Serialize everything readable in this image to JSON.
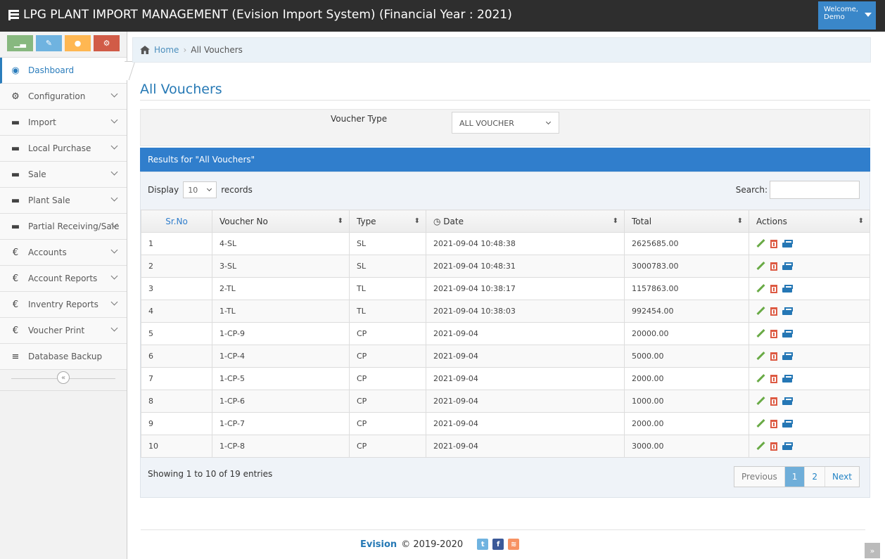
{
  "header": {
    "title": "LPG PLANT IMPORT MANAGEMENT (Evision Import System) (Financial Year : 2021)",
    "welcome": "Welcome,",
    "user": "Demo"
  },
  "sidebar": {
    "items": [
      {
        "label": "Dashboard",
        "icon": "tachometer-icon",
        "active": true
      },
      {
        "label": "Configuration",
        "icon": "cogs-icon"
      },
      {
        "label": "Import",
        "icon": "cart-icon"
      },
      {
        "label": "Local Purchase",
        "icon": "cart-icon"
      },
      {
        "label": "Sale",
        "icon": "cart-icon"
      },
      {
        "label": "Plant Sale",
        "icon": "cart-icon"
      },
      {
        "label": "Partial Receiving/Sale",
        "icon": "cart-icon"
      },
      {
        "label": "Accounts",
        "icon": "euro-icon"
      },
      {
        "label": "Account Reports",
        "icon": "euro-icon"
      },
      {
        "label": "Inventry Reports",
        "icon": "euro-icon"
      },
      {
        "label": "Voucher Print",
        "icon": "euro-icon"
      },
      {
        "label": "Database Backup",
        "icon": "database-icon"
      }
    ]
  },
  "breadcrumb": {
    "home": "Home",
    "current": "All Vouchers"
  },
  "page": {
    "title": "All Vouchers"
  },
  "filter": {
    "label": "Voucher Type",
    "selected": "ALL VOUCHER"
  },
  "results": {
    "header": "Results for \"All Vouchers\""
  },
  "table": {
    "display_label": "Display",
    "records_label": "records",
    "length": "10",
    "search_label": "Search:",
    "columns": [
      "Sr.No",
      "Voucher No",
      "Type",
      "Date",
      "Total",
      "Actions"
    ],
    "rows": [
      [
        "1",
        "4-SL",
        "SL",
        "2021-09-04 10:48:38",
        "2625685.00"
      ],
      [
        "2",
        "3-SL",
        "SL",
        "2021-09-04 10:48:31",
        "3000783.00"
      ],
      [
        "3",
        "2-TL",
        "TL",
        "2021-09-04 10:38:17",
        "1157863.00"
      ],
      [
        "4",
        "1-TL",
        "TL",
        "2021-09-04 10:38:03",
        "992454.00"
      ],
      [
        "5",
        "1-CP-9",
        "CP",
        "2021-09-04",
        "20000.00"
      ],
      [
        "6",
        "1-CP-4",
        "CP",
        "2021-09-04",
        "5000.00"
      ],
      [
        "7",
        "1-CP-5",
        "CP",
        "2021-09-04",
        "2000.00"
      ],
      [
        "8",
        "1-CP-6",
        "CP",
        "2021-09-04",
        "1000.00"
      ],
      [
        "9",
        "1-CP-7",
        "CP",
        "2021-09-04",
        "2000.00"
      ],
      [
        "10",
        "1-CP-8",
        "CP",
        "2021-09-04",
        "3000.00"
      ]
    ],
    "info": "Showing 1 to 10 of 19 entries"
  },
  "pagination": {
    "previous": "Previous",
    "page1": "1",
    "page2": "2",
    "next": "Next"
  },
  "footer": {
    "brand": "Evision",
    "copyright": "© 2019-2020"
  },
  "colors": {
    "navbar": "#2e2e2e",
    "accent": "#307ecc",
    "title": "#2679b5"
  }
}
